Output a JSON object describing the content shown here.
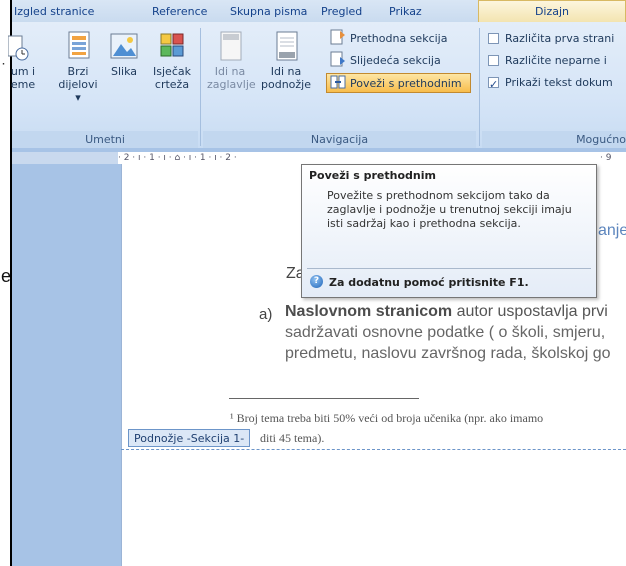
{
  "tabs": [
    {
      "label": "Izgled stranice"
    },
    {
      "label": "Reference"
    },
    {
      "label": "Skupna pisma"
    },
    {
      "label": "Pregled"
    },
    {
      "label": "Prikaz"
    },
    {
      "label": "Dizajn",
      "active": true
    }
  ],
  "left_strip": {
    "letters": [
      "e"
    ]
  },
  "ribbon": {
    "umetni": {
      "label": "Umetni",
      "buttons": [
        {
          "line1": "um i",
          "line2": "eme",
          "icon": "date-time-icon"
        },
        {
          "line1": "Brzi",
          "line2": "dijelovi ▾",
          "icon": "quick-parts-icon"
        },
        {
          "line1": "Slika",
          "line2": "",
          "icon": "picture-icon"
        },
        {
          "line1": "Isječak",
          "line2": "crteža",
          "icon": "clip-art-icon"
        }
      ]
    },
    "navigacija": {
      "label": "Navigacija",
      "big_buttons": [
        {
          "line1": "Idi na",
          "line2": "zaglavlje",
          "icon": "go-to-header-icon"
        },
        {
          "line1": "Idi na",
          "line2": "podnožje",
          "icon": "go-to-footer-icon"
        }
      ],
      "small_buttons": [
        {
          "label": "Prethodna sekcija",
          "icon": "previous-section-icon"
        },
        {
          "label": "Slijedeća sekcija",
          "icon": "next-section-icon"
        },
        {
          "label": "Poveži s prethodnim",
          "icon": "link-to-previous-icon",
          "highlighted": true
        }
      ]
    },
    "mogucnosti": {
      "label": "Mogućno",
      "checkboxes": [
        {
          "label": "Različita prva strani",
          "checked": false
        },
        {
          "label": "Različite neparne i",
          "checked": false
        },
        {
          "label": "Prikaži tekst dokum",
          "checked": true
        }
      ]
    }
  },
  "ruler": {
    "text": "· 2 · ı · 1 · ı · ⌂ · ı · 1 · ı · 2 ·",
    "right_text": "· 9"
  },
  "document": {
    "bullet_dashes": [
      "-",
      "-",
      "-"
    ],
    "partial_right": "anje",
    "partial_za": "Za",
    "item_letter": "a)",
    "item_bold": "Naslovnom stranicom",
    "item_rest": " autor uspostavlja prvi",
    "item_line2": "sadržavati osnovne podatke ( o školi, smjeru,",
    "item_line3": "predmetu, naslovu završnog rada, školskoj go",
    "footnote_line1": "¹ Broj tema treba biti 50% veći od broja učenika (npr. ako imamo",
    "footnote_line2": "diti 45 tema)."
  },
  "tooltip": {
    "title": "Poveži s prethodnim",
    "body": "Povežite s prethodnom sekcijom tako da zaglavlje i podnožje u trenutnoj sekciji imaju isti sadržaj kao i prethodna sekcija.",
    "help": "Za dodatnu pomoć pritisnite F1."
  },
  "footer_label": "Podnožje -Sekcija 1-",
  "colors": {
    "active_tab": "#f3e4b0",
    "ribbon": "#d6e5f7",
    "highlight": "#f8bd4c",
    "footer_border": "#6c95c9"
  }
}
